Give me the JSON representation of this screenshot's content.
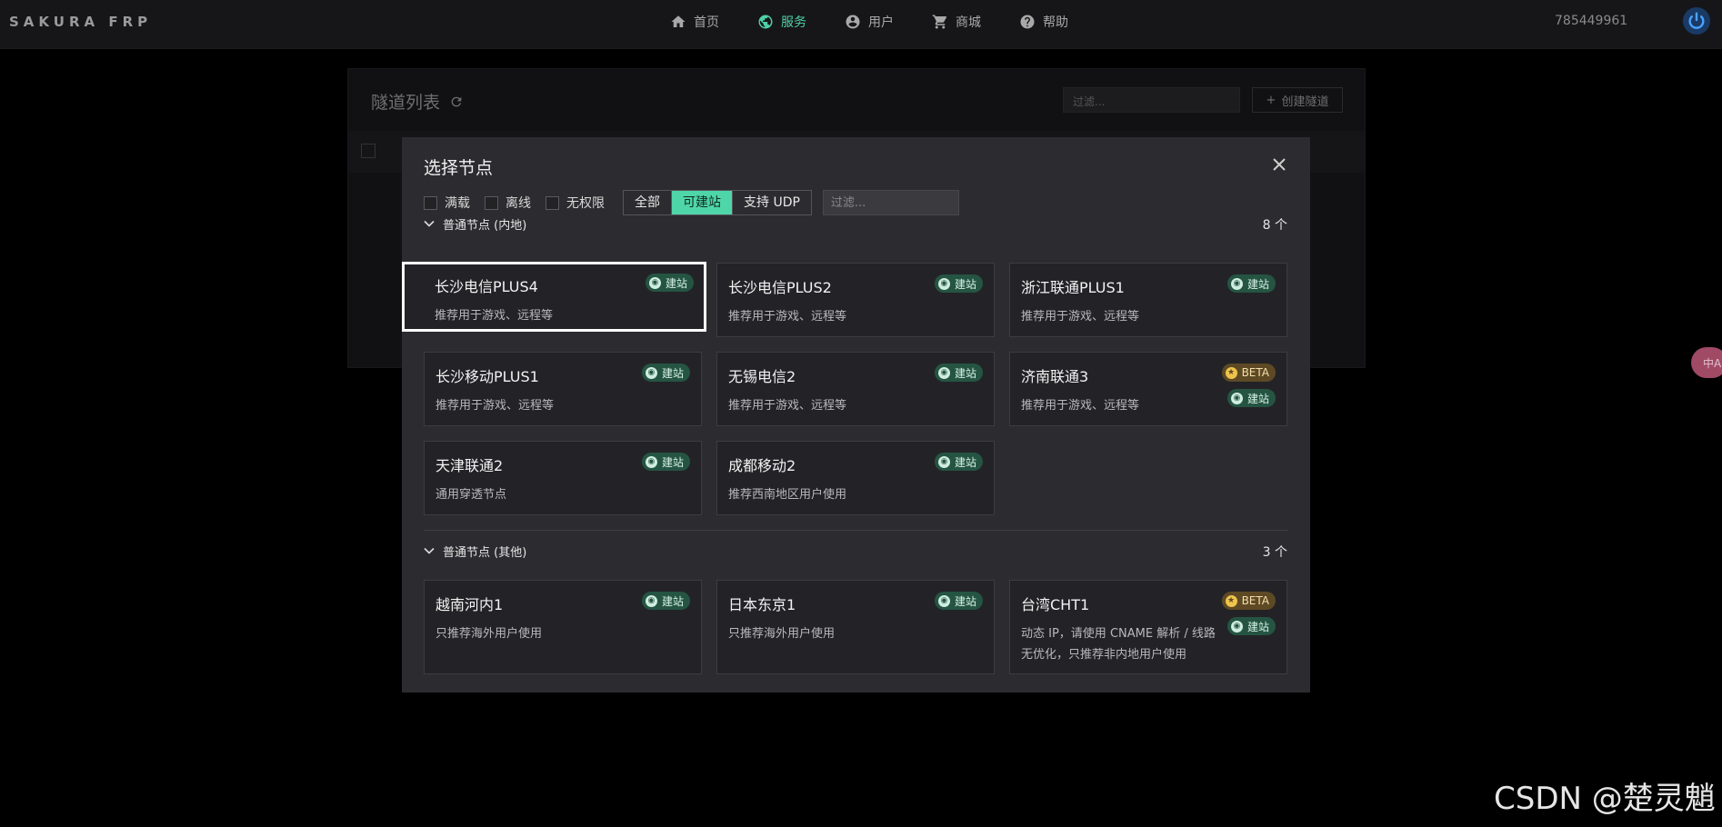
{
  "header": {
    "logo": "SAKURA FRP",
    "nav": [
      {
        "label": "首页",
        "icon": "home-icon"
      },
      {
        "label": "服务",
        "icon": "globe-icon"
      },
      {
        "label": "用户",
        "icon": "user-icon"
      },
      {
        "label": "商城",
        "icon": "cart-icon"
      },
      {
        "label": "帮助",
        "icon": "help-icon"
      }
    ],
    "active_nav": "服务",
    "user_id": "785449961"
  },
  "background": {
    "title": "隧道列表",
    "filter_placeholder": "过滤...",
    "create_label": "创建隧道",
    "side_badge": "中A"
  },
  "modal": {
    "title": "选择节点",
    "checkboxes": [
      "满载",
      "离线",
      "无权限"
    ],
    "segments": [
      "全部",
      "可建站",
      "支持 UDP"
    ],
    "active_segment": "可建站",
    "search_placeholder": "过滤...",
    "groups": [
      {
        "title": "普通节点 (内地)",
        "count": "8 个",
        "nodes": [
          {
            "name": "长沙电信PLUS4",
            "desc": "推荐用于游戏、远程等",
            "tags": [
              "建站"
            ],
            "selected": true
          },
          {
            "name": "长沙电信PLUS2",
            "desc": "推荐用于游戏、远程等",
            "tags": [
              "建站"
            ]
          },
          {
            "name": "浙江联通PLUS1",
            "desc": "推荐用于游戏、远程等",
            "tags": [
              "建站"
            ]
          },
          {
            "name": "长沙移动PLUS1",
            "desc": "推荐用于游戏、远程等",
            "tags": [
              "建站"
            ]
          },
          {
            "name": "无锡电信2",
            "desc": "推荐用于游戏、远程等",
            "tags": [
              "建站"
            ]
          },
          {
            "name": "济南联通3",
            "desc": "推荐用于游戏、远程等",
            "tags": [
              "BETA",
              "建站"
            ]
          },
          {
            "name": "天津联通2",
            "desc": "通用穿透节点",
            "tags": [
              "建站"
            ]
          },
          {
            "name": "成都移动2",
            "desc": "推荐西南地区用户使用",
            "tags": [
              "建站"
            ]
          }
        ]
      },
      {
        "title": "普通节点 (其他)",
        "count": "3 个",
        "nodes": [
          {
            "name": "越南河内1",
            "desc": "只推荐海外用户使用",
            "tags": [
              "建站"
            ]
          },
          {
            "name": "日本东京1",
            "desc": "只推荐海外用户使用",
            "tags": [
              "建站"
            ]
          },
          {
            "name": "台湾CHT1",
            "desc": "动态 IP，请使用 CNAME 解析 / 线路无优化，只推荐非内地用户使用",
            "tags": [
              "BETA",
              "建站"
            ]
          }
        ]
      }
    ]
  },
  "watermark": "CSDN @楚灵魈",
  "colors": {
    "accent": "#4fd6a8",
    "site_tag": "#255443",
    "beta_tag": "#5d4a25",
    "background": "#000000",
    "modal": "#2c2c30"
  }
}
